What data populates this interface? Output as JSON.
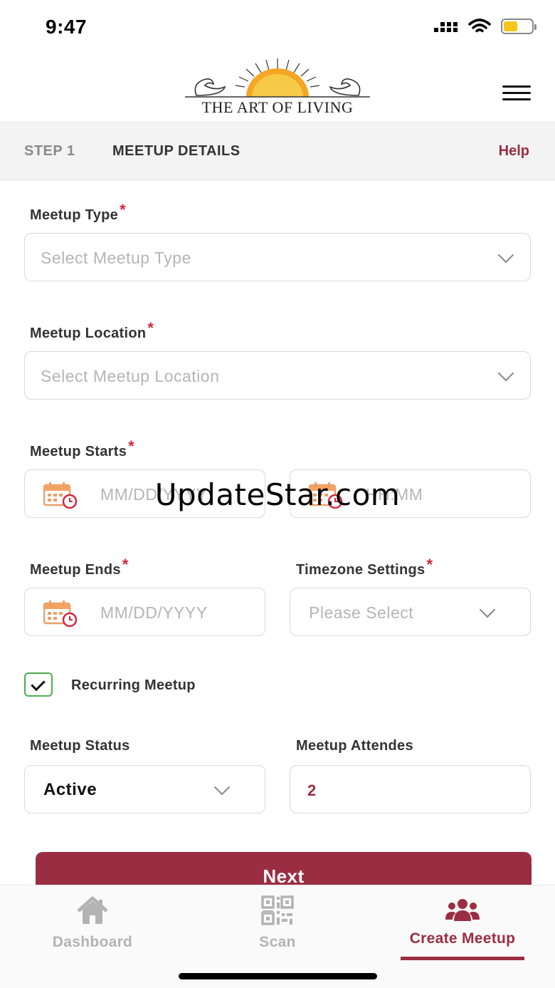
{
  "status_bar": {
    "time": "9:47"
  },
  "header": {
    "logo_text": "THE ART OF LIVING"
  },
  "step_bar": {
    "step": "STEP 1",
    "title": "MEETUP DETAILS",
    "help": "Help"
  },
  "form": {
    "meetup_type": {
      "label": "Meetup Type",
      "required": "*",
      "placeholder": "Select Meetup Type"
    },
    "meetup_location": {
      "label": "Meetup Location",
      "required": "*",
      "placeholder": "Select Meetup Location"
    },
    "meetup_starts": {
      "label": "Meetup Starts",
      "required": "*",
      "date_placeholder": "MM/DD/YYYY",
      "time_placeholder": "HH:MM"
    },
    "meetup_ends": {
      "label": "Meetup Ends",
      "required": "*",
      "date_placeholder": "MM/DD/YYYY"
    },
    "timezone": {
      "label": "Timezone Settings",
      "required": "*",
      "placeholder": "Please Select"
    },
    "recurring": {
      "label": "Recurring Meetup",
      "checked": true
    },
    "meetup_status": {
      "label": "Meetup Status",
      "value": "Active"
    },
    "meetup_attendees": {
      "label": "Meetup Attendes",
      "value": "2"
    }
  },
  "next_button": {
    "label": "Next"
  },
  "tabs": [
    {
      "label": "Dashboard",
      "icon": "home-icon",
      "active": false
    },
    {
      "label": "Scan",
      "icon": "qr-code-icon",
      "active": false
    },
    {
      "label": "Create Meetup",
      "icon": "group-icon",
      "active": true
    }
  ],
  "watermark": {
    "text": "UpdateStar.com"
  },
  "colors": {
    "accent": "#9b2d42",
    "required": "#d7263d",
    "checkbox_border": "#4caf50",
    "sun": "#f5a623"
  }
}
